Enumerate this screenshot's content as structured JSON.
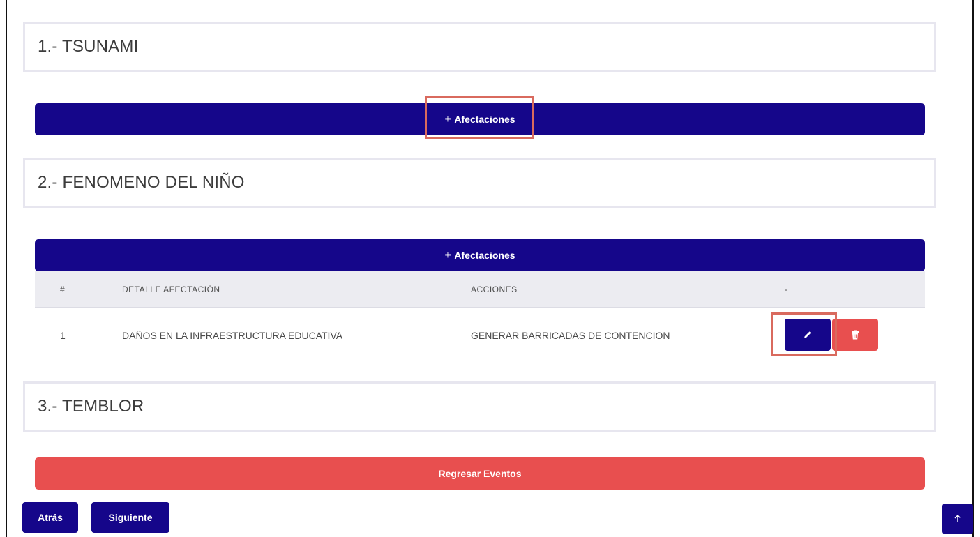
{
  "events": [
    {
      "title": "1.- TSUNAMI"
    },
    {
      "title": "2.- FENOMENO DEL NIÑO"
    },
    {
      "title": "3.- TEMBLOR"
    }
  ],
  "add_affectations_label": "Afectaciones",
  "add_affectations_icon": "plus-icon",
  "table": {
    "headers": [
      "#",
      "DETALLE AFECTACIÓN",
      "ACCIONES",
      "-"
    ],
    "rows": [
      {
        "num": "1",
        "detail": "DAÑOS EN LA INFRAESTRUCTURA EDUCATIVA",
        "action": "GENERAR BARRICADAS DE CONTENCION"
      }
    ]
  },
  "icons": {
    "edit": "pencil-icon",
    "delete": "trash-icon",
    "scroll_top": "arrow-up-icon"
  },
  "back_events_label": "Regresar Eventos",
  "nav": {
    "back_label": "Atrás",
    "next_label": "Siguiente"
  },
  "colors": {
    "primary": "#15068a",
    "danger": "#e84f4f",
    "highlight": "#d96a5e"
  }
}
